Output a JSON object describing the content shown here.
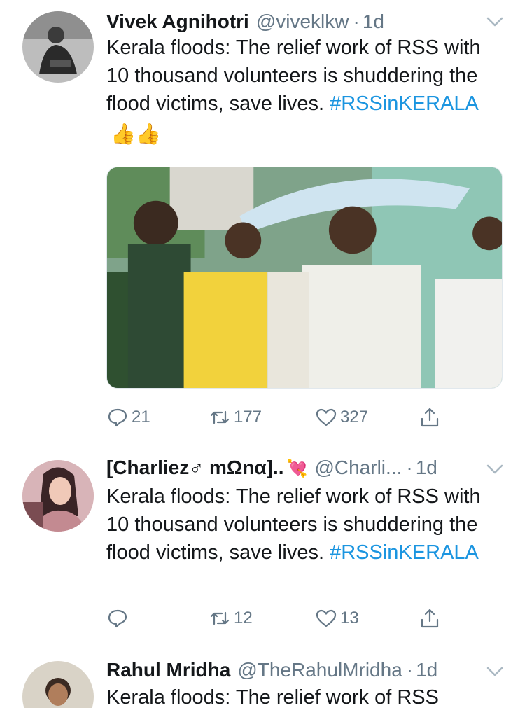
{
  "tweets": [
    {
      "display_name": "Vivek Agnihotri",
      "handle": "@viveklkw",
      "separator": "·",
      "time": "1d",
      "text": "Kerala floods: The relief work of RSS with 10 thousand volunteers is shuddering the flood victims, save lives.",
      "hashtag": "#RSSinKERALA",
      "emoji": "👍👍",
      "replies": "21",
      "retweets": "177",
      "likes": "327",
      "has_media": true
    },
    {
      "display_name": "[Charliez♂ mΩnα]..",
      "name_emoji": "💘",
      "handle": "@Charli...",
      "separator": "·",
      "time": "1d",
      "text": "Kerala floods: The relief work of RSS with 10 thousand volunteers is shuddering the flood victims, save lives.",
      "hashtag": "#RSSinKERALA",
      "replies": "",
      "retweets": "12",
      "likes": "13",
      "has_media": false
    },
    {
      "display_name": "Rahul Mridha",
      "handle": "@TheRahulMridha",
      "separator": "·",
      "time": "1d",
      "text": "Kerala floods: The relief work of RSS",
      "has_media": false
    }
  ],
  "icons": {
    "reply": "reply-icon",
    "retweet": "retweet-icon",
    "like": "heart-icon",
    "share": "share-icon",
    "caret": "chevron-down-icon"
  },
  "colors": {
    "text": "#14171a",
    "secondary": "#657786",
    "hashtag": "#1b95e0",
    "divider": "#e1e8ed"
  }
}
